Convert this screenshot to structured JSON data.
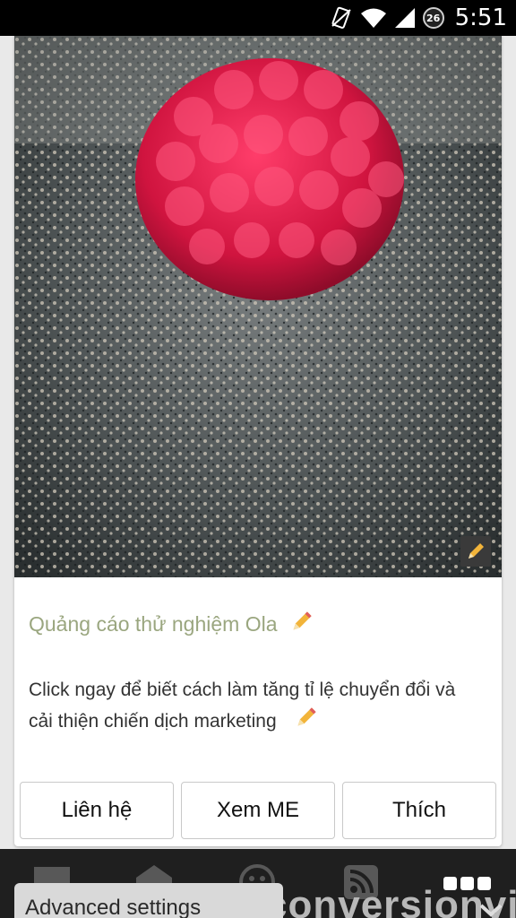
{
  "status_bar": {
    "time": "5:51",
    "battery_level": "26",
    "icons": [
      "no-sim-icon",
      "wifi-icon",
      "signal-icon",
      "battery-icon"
    ]
  },
  "ad": {
    "image": "raspberry-on-soil",
    "title": "Quảng cáo thử nghiệm Ola",
    "description": "Click ngay để biết cách làm tăng tỉ lệ chuyển đổi và cải thiện chiến dịch marketing",
    "buttons": {
      "contact": "Liên hệ",
      "view": "Xem ME",
      "like": "Thích"
    },
    "title_color": "#9aa67f"
  },
  "bottom_bar": {
    "advanced_settings": "Advanced settings",
    "watermark": "conversionvi",
    "icons": [
      "chat-icon",
      "store-icon",
      "emoji-icon",
      "rss-icon",
      "menu-dots-icon"
    ]
  }
}
